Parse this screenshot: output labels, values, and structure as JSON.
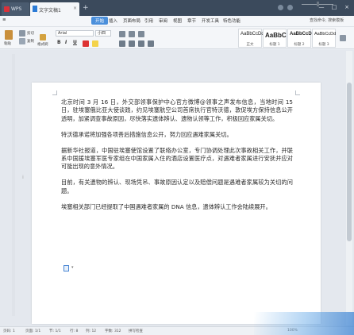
{
  "window": {
    "tab_app": "WPS",
    "tab_doc": "文字文稿1",
    "tab_doc_close": "×",
    "tab_add": "+",
    "minimize": "—",
    "maximize": "□",
    "close": "×"
  },
  "menu": {
    "active": "开始",
    "items": [
      "插入",
      "页面布局",
      "引用",
      "审阅",
      "视图",
      "章节",
      "开发工具",
      "特色功能"
    ],
    "search": "查找命令, 搜索模板"
  },
  "toolbar": {
    "paste": "粘贴",
    "cut": "剪切",
    "copy": "复制",
    "format_painter": "格式刷",
    "font": "Arial",
    "size": "小四",
    "bold": "B",
    "italic": "I",
    "underline": "U",
    "styles": [
      {
        "sample": "AaBbCcDd",
        "name": "正文"
      },
      {
        "sample": "AaBbC",
        "name": "标题 1"
      },
      {
        "sample": "AaBbCcD",
        "name": "标题 2"
      },
      {
        "sample": "AaBbCcDd",
        "name": "标题 3"
      }
    ]
  },
  "document": {
    "paragraphs": [
      "北京时间 3 月 16 日，外交部领事保护中心官方微博@领事之声发布信息，当地时间 15 日，驻埃塞俄比亚大使谈践，约见埃塞航空公司首席执行官特沃德，敦促埃方保持信息公开透明，加紧调查事故原因，尽快落实遗体辨认、遗物认领等工作，积极回应家属关切。",
      "特沃德承诺将加强各项善后措施信息公开，努力回应遇难家属关切。",
      "据新华社报道，中国驻埃塞使馆设置了联络办公室，专门协调处理此次事故相关工作，并联系中国援埃塞军医专家组在中国家属入住的酒店设置医疗点，对遇难者家属进行安抚并应对可能出现的意外情况。",
      "目前，有关遗物的辨认、现场凭吊、事故原因认定以及赔偿问题是遇难者家属较为关切的问题。",
      "埃塞相关部门已经提取了中国遇难者家属的 DNA 信息，遗体辨认工作会陆续展开。"
    ]
  },
  "status": {
    "page_num": "页码: 1",
    "pages": "页面: 1/1",
    "section": "节: 1/1",
    "row": "行: 8",
    "column": "列: 12",
    "words": "字数: 312",
    "spell": "拼写检查",
    "zoom": "100%"
  }
}
